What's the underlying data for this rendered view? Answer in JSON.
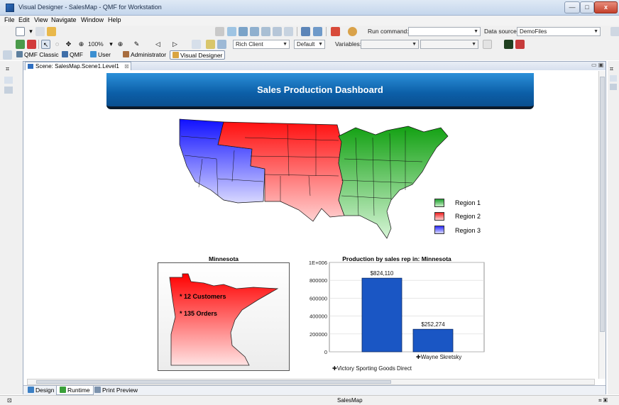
{
  "window": {
    "title": "Visual Designer - SalesMap - QMF for Workstation",
    "buttons": {
      "minimize": "—",
      "maximize": "□",
      "close": "x"
    }
  },
  "menu": [
    "File",
    "Edit",
    "View",
    "Navigate",
    "Window",
    "Help"
  ],
  "toolbar1": {
    "run_command_label": "Run command:",
    "run_command_value": "",
    "data_source_label": "Data source:",
    "data_source_value": "DemoFiles"
  },
  "toolbar2": {
    "zoom": "100%",
    "client_select": "Rich Client",
    "mode_select": "Default",
    "variables_label": "Variables:"
  },
  "perspectives": [
    "QMF Classic",
    "QMF",
    "User",
    "Administrator",
    "Visual Designer"
  ],
  "editor": {
    "tab_label": "Scene: SalesMap.Scene1.Level1"
  },
  "dashboard": {
    "title": "Sales Production Dashboard",
    "legend": [
      {
        "label": "Region 1",
        "color": "#1e9e2e"
      },
      {
        "label": "Region 2",
        "color": "#ee2020"
      },
      {
        "label": "Region 3",
        "color": "#2a2aff"
      }
    ],
    "state_panel": {
      "title": "Minnesota",
      "line1": "* 12 Customers",
      "line2": "* 135 Orders"
    }
  },
  "chart_data": {
    "type": "bar",
    "title": "Production by sales rep in: Minnesota",
    "categories": [
      "Victory Sporting Goods Direct",
      "Wayne Skretsky"
    ],
    "values": [
      824110,
      252274
    ],
    "data_labels": [
      "$824,110",
      "$252,274"
    ],
    "yticks": [
      "1E+006",
      "800000",
      "600000",
      "400000",
      "200000",
      "0"
    ],
    "ylim": [
      0,
      1000000
    ],
    "bar_color": "#1a56c4",
    "grid": true
  },
  "bottom_tabs": [
    "Design",
    "Runtime",
    "Print Preview"
  ],
  "status": {
    "center": "SalesMap"
  }
}
